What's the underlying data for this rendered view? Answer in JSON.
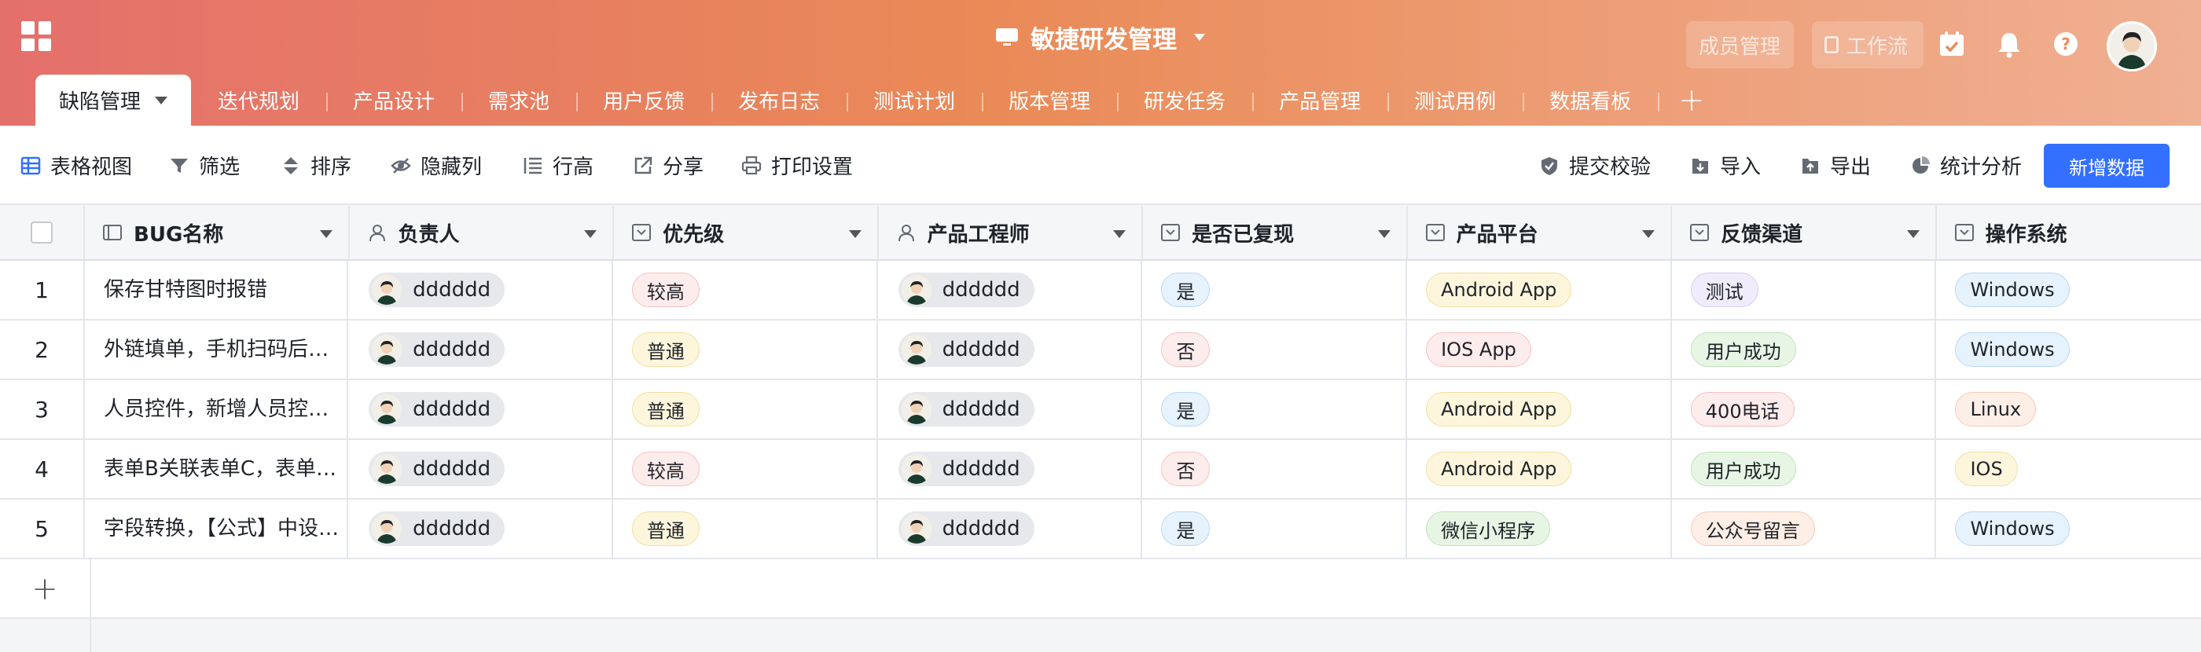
{
  "app": {
    "title": "敏捷研发管理"
  },
  "header": {
    "member_btn": "成员管理",
    "workflow_btn": "工作流"
  },
  "tabs": [
    {
      "label": "缺陷管理"
    },
    {
      "label": "迭代规划"
    },
    {
      "label": "产品设计"
    },
    {
      "label": "需求池"
    },
    {
      "label": "用户反馈"
    },
    {
      "label": "发布日志"
    },
    {
      "label": "测试计划"
    },
    {
      "label": "版本管理"
    },
    {
      "label": "研发任务"
    },
    {
      "label": "产品管理"
    },
    {
      "label": "测试用例"
    },
    {
      "label": "数据看板"
    }
  ],
  "toolbar": {
    "grid_view": "表格视图",
    "filter": "筛选",
    "sort": "排序",
    "hide_cols": "隐藏列",
    "row_height": "行高",
    "share": "分享",
    "print": "打印设置",
    "validate": "提交校验",
    "import": "导入",
    "export": "导出",
    "stats": "统计分析",
    "add_data": "新增数据"
  },
  "columns": [
    "BUG名称",
    "负责人",
    "优先级",
    "产品工程师",
    "是否已复现",
    "产品平台",
    "反馈渠道",
    "操作系统"
  ],
  "rows": [
    {
      "num": "1",
      "name": "保存甘特图时报错",
      "owner": "dddddd",
      "priority": "较高",
      "engineer": "dddddd",
      "reproduced": "是",
      "platform": "Android App",
      "channel": "测试",
      "os": "Windows"
    },
    {
      "num": "2",
      "name": "外链填单，手机扫码后填…",
      "owner": "dddddd",
      "priority": "普通",
      "engineer": "dddddd",
      "reproduced": "否",
      "platform": "IOS App",
      "channel": "用户成功",
      "os": "Windows"
    },
    {
      "num": "3",
      "name": "人员控件，新增人员控件…",
      "owner": "dddddd",
      "priority": "普通",
      "engineer": "dddddd",
      "reproduced": "是",
      "platform": "Android App",
      "channel": "400电话",
      "os": "Linux"
    },
    {
      "num": "4",
      "name": "表单B关联表单C，表单A…",
      "owner": "dddddd",
      "priority": "较高",
      "engineer": "dddddd",
      "reproduced": "否",
      "platform": "Android App",
      "channel": "用户成功",
      "os": "IOS"
    },
    {
      "num": "5",
      "name": "字段转换，【公式】中设…",
      "owner": "dddddd",
      "priority": "普通",
      "engineer": "dddddd",
      "reproduced": "是",
      "platform": "微信小程序",
      "channel": "公众号留言",
      "os": "Windows"
    }
  ],
  "colors": {
    "primary": "#3370ff",
    "header_start": "#e4706c",
    "header_end": "#f0b093"
  }
}
